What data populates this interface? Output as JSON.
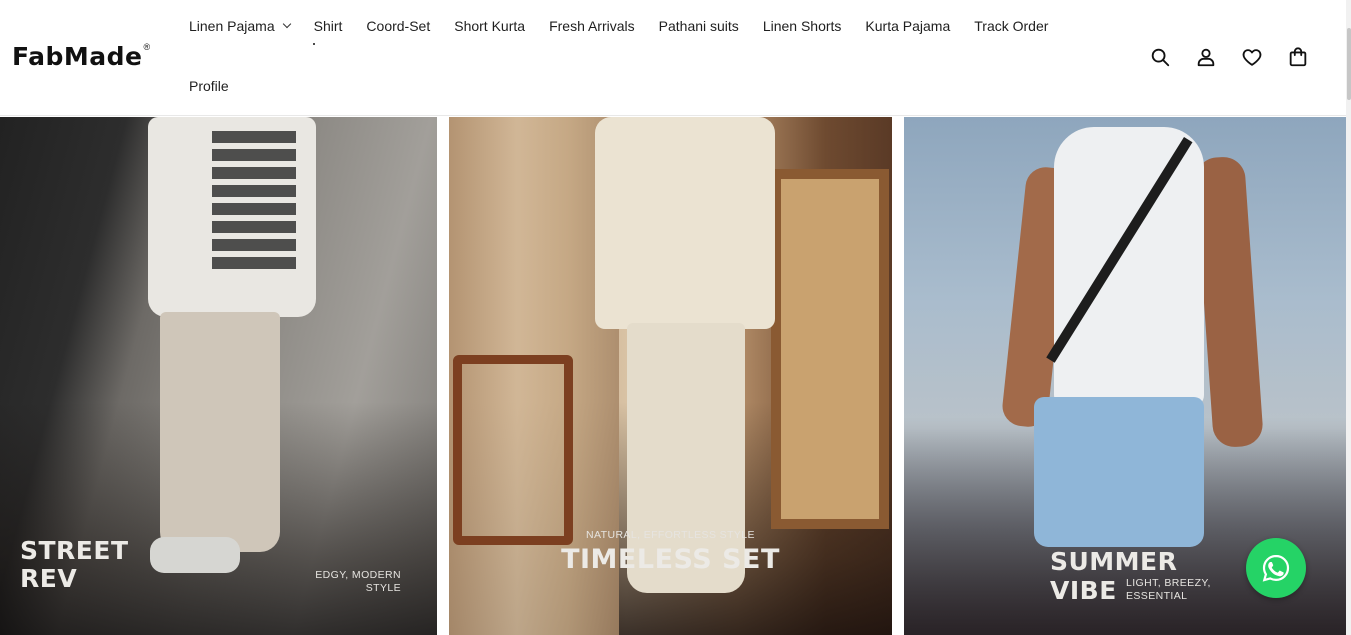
{
  "brand": {
    "logo_text": "FabMade",
    "logo_mark": "®"
  },
  "nav": {
    "row1": [
      {
        "label": "Linen Pajama",
        "has_dropdown": true
      },
      {
        "label": "Shirt"
      },
      {
        "label": "Coord-Set"
      },
      {
        "label": "Short Kurta"
      },
      {
        "label": "Fresh Arrivals"
      },
      {
        "label": "Pathani suits"
      },
      {
        "label": "Linen Shorts"
      },
      {
        "label": "Kurta Pajama"
      },
      {
        "label": "Track Order"
      }
    ],
    "row2": [
      {
        "label": "Profile"
      }
    ]
  },
  "header_icons": [
    "search-icon",
    "account-icon",
    "wishlist-heart-icon",
    "cart-bag-icon"
  ],
  "banners": [
    {
      "title": "Street Rev",
      "title_line1": "STREET",
      "title_line2": "REV",
      "subtitle_line1": "EDGY, MODERN",
      "subtitle_line2": "STYLE"
    },
    {
      "title": "TIMELESS SET",
      "subtitle": "NATURAL, EFFORTLESS STYLE"
    },
    {
      "title_line1": "SUMMER",
      "title_line2": "VIBE",
      "subtitle_line1": "LIGHT, BREEZY,",
      "subtitle_line2": "ESSENTIAL"
    }
  ],
  "colors": {
    "whatsapp": "#25d366",
    "text": "#1a1a1a"
  },
  "floating_action": {
    "icon": "whatsapp-icon"
  }
}
